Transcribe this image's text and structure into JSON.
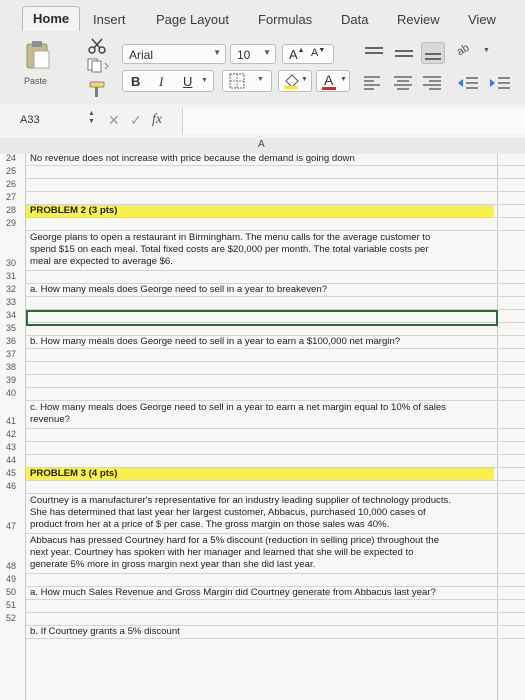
{
  "ribbon": {
    "tabs": [
      "Home",
      "Insert",
      "Page Layout",
      "Formulas",
      "Data",
      "Review",
      "View"
    ],
    "font_name": "Arial",
    "font_size": "10",
    "paste_label": "Paste",
    "bold": "B",
    "italic": "I",
    "underline": "U",
    "font_color_glyph": "A",
    "grow_glyph": "A",
    "shrink_glyph": "A"
  },
  "formula_bar": {
    "name_box": "A33",
    "fx": "fx",
    "value": ""
  },
  "sheet": {
    "column_header": "A",
    "rows": [
      {
        "n": "24",
        "text": "No revenue does not increase with price because the demand is going down"
      },
      {
        "n": "25",
        "text": ""
      },
      {
        "n": "26",
        "text": ""
      },
      {
        "n": "27",
        "text": ""
      },
      {
        "n": "28",
        "text": "PROBLEM 2 (3 pts)"
      },
      {
        "n": "29",
        "text": ""
      },
      {
        "n": "30",
        "lines": [
          "George plans to open a restaurant in Birmingham. The menu calls for the average customer to",
          "spend $15 on each meal. Total fixed costs are $20,000 per month. The total variable costs per",
          "meal are expected to average $6."
        ]
      },
      {
        "n": "31",
        "text": ""
      },
      {
        "n": "32",
        "text": "a. How many meals does George need to sell in a year to breakeven?"
      },
      {
        "n": "33",
        "text": ""
      },
      {
        "n": "34",
        "text": ""
      },
      {
        "n": "35",
        "text": ""
      },
      {
        "n": "36",
        "text": "b. How many meals does George need to sell in a year to earn a $100,000 net margin?"
      },
      {
        "n": "37",
        "text": ""
      },
      {
        "n": "38",
        "text": ""
      },
      {
        "n": "39",
        "text": ""
      },
      {
        "n": "40",
        "text": ""
      },
      {
        "n": "41",
        "lines": [
          "c. How many meals does George need to sell in a year to earn a net margin equal to 10% of sales",
          "revenue?"
        ]
      },
      {
        "n": "42",
        "text": ""
      },
      {
        "n": "43",
        "text": ""
      },
      {
        "n": "44",
        "text": ""
      },
      {
        "n": "45",
        "text": "PROBLEM 3 (4 pts)"
      },
      {
        "n": "46",
        "text": ""
      },
      {
        "n": "47",
        "lines": [
          "Courtney is a manufacturer's representative for an industry leading supplier of technology products.",
          "She has determined that last year her largest customer, Abbacus, purchased 10,000 cases of",
          "product from her at a price of $    per case. The gross margin on those sales was 40%."
        ]
      },
      {
        "n": "48",
        "lines": [
          "Abbacus has pressed Courtney hard for a 5% discount (reduction in selling price) throughout the",
          "next year. Courtney has spoken with her manager and learned that she will be expected to",
          "generate 5% more in gross margin next year than she did last year."
        ]
      },
      {
        "n": "49",
        "text": ""
      },
      {
        "n": "50",
        "text": "a. How much Sales Revenue and Gross Margin did Courtney generate from Abbacus last year?"
      },
      {
        "n": "51",
        "text": ""
      },
      {
        "n": "52",
        "text": ""
      },
      {
        "n": "",
        "text": "b. If Courtney grants a 5% discount"
      }
    ]
  }
}
